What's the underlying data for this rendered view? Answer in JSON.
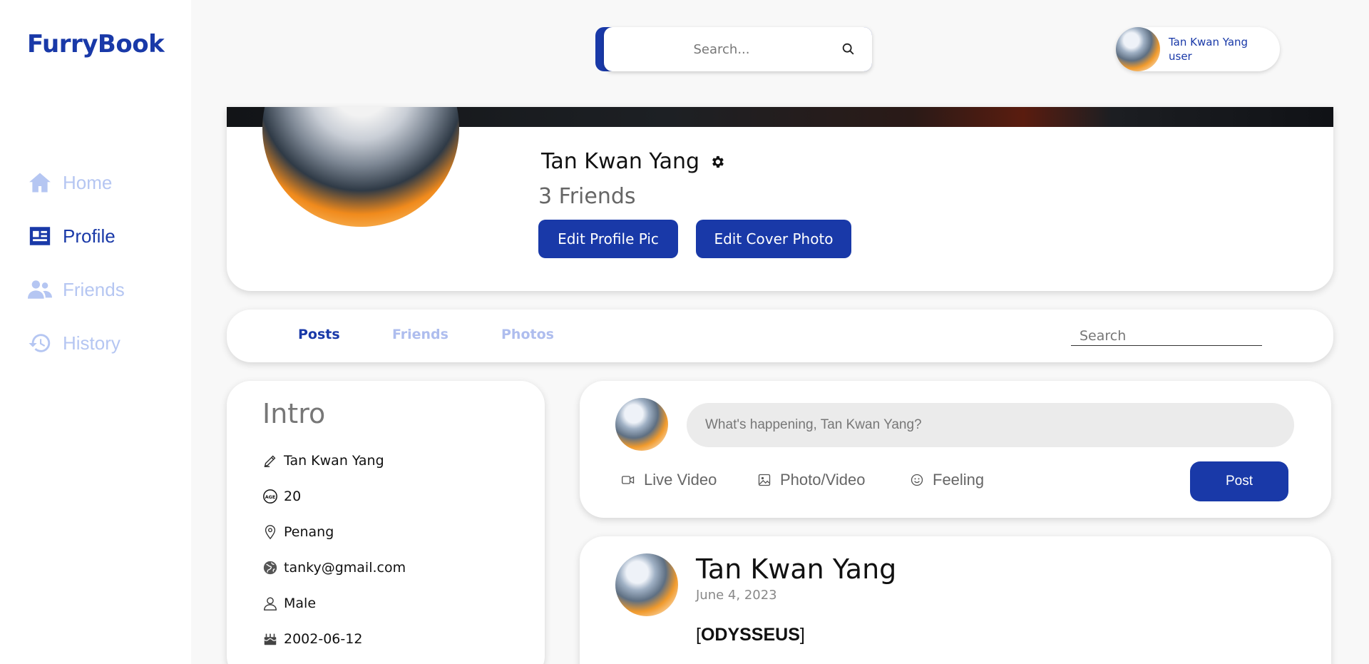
{
  "app": {
    "logo": "FurryBook"
  },
  "sidebar": {
    "items": [
      {
        "label": "Home",
        "icon": "home-icon"
      },
      {
        "label": "Profile",
        "icon": "id-card-icon"
      },
      {
        "label": "Friends",
        "icon": "users-icon"
      },
      {
        "label": "History",
        "icon": "history-icon"
      }
    ]
  },
  "header": {
    "search": {
      "placeholder": "Search..."
    },
    "user": {
      "name": "Tan Kwan Yang",
      "role": "user"
    }
  },
  "profile": {
    "name": "Tan Kwan Yang",
    "friends_count": "3 Friends",
    "edit_profile_pic_label": "Edit Profile Pic",
    "edit_cover_photo_label": "Edit Cover Photo"
  },
  "tabs": {
    "items": [
      {
        "label": "Posts"
      },
      {
        "label": "Friends"
      },
      {
        "label": "Photos"
      }
    ],
    "search_placeholder": "Search"
  },
  "intro": {
    "title": "Intro",
    "name": "Tan Kwan Yang",
    "age": "20",
    "location": "Penang",
    "email": "tanky@gmail.com",
    "gender": "Male",
    "birthday": "2002-06-12"
  },
  "composer": {
    "placeholder": "What's happening, Tan Kwan Yang?",
    "actions": [
      {
        "label": "Live Video"
      },
      {
        "label": "Photo/Video"
      },
      {
        "label": "Feeling"
      }
    ],
    "post_label": "Post"
  },
  "feed": {
    "posts": [
      {
        "author": "Tan Kwan Yang",
        "date": "June 4, 2023",
        "bracket_open": "[",
        "body": "ODYSSEUS",
        "bracket_close": "]"
      }
    ]
  },
  "colors": {
    "primary": "#1939a8",
    "nav_inactive": "#b5c6f2",
    "tab_inactive": "#aebdee",
    "background": "#f8f8f8"
  }
}
